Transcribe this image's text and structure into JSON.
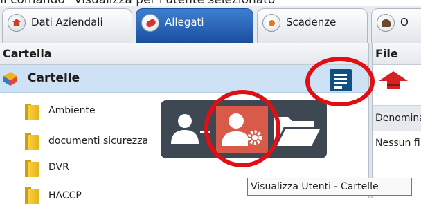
{
  "caption": "Il comando \"Visualizza per l'utente selezionato\"",
  "tabs": [
    {
      "label": "Dati Aziendali",
      "icon": "home-icon",
      "active": false
    },
    {
      "label": "Allegati",
      "icon": "tag-icon",
      "active": true
    },
    {
      "label": "Scadenze",
      "icon": "clock-icon",
      "active": false
    },
    {
      "label": "O",
      "icon": "people-icon",
      "active": false
    }
  ],
  "left_panel": {
    "header": "Cartella",
    "root": {
      "label": "Cartelle",
      "icon": "folder-tree-icon"
    },
    "folders": [
      "Ambiente",
      "documenti sicurezza",
      "DVR",
      "HACCP"
    ],
    "action_icon": "list-view-icon"
  },
  "right_panel": {
    "header": "File",
    "up_icon": "up-arrow-icon",
    "column_header": "Denominazione",
    "empty_text": "Nessun file"
  },
  "floating_toolbar": {
    "buttons": [
      {
        "name": "add-user",
        "icon": "user-add-icon",
        "active": false
      },
      {
        "name": "view-users",
        "icon": "user-gear-icon",
        "active": true
      },
      {
        "name": "open-folder",
        "icon": "open-folder-icon",
        "active": false
      }
    ],
    "background": "#3e4852",
    "active_color": "#d85b4a"
  },
  "tooltip": "Visualizza Utenti - Cartelle",
  "colors": {
    "selected_row": "#cfe1f5",
    "active_tab": "#2563b8",
    "highlight_ring": "#e10e13",
    "list_button": "#0f4f84"
  }
}
